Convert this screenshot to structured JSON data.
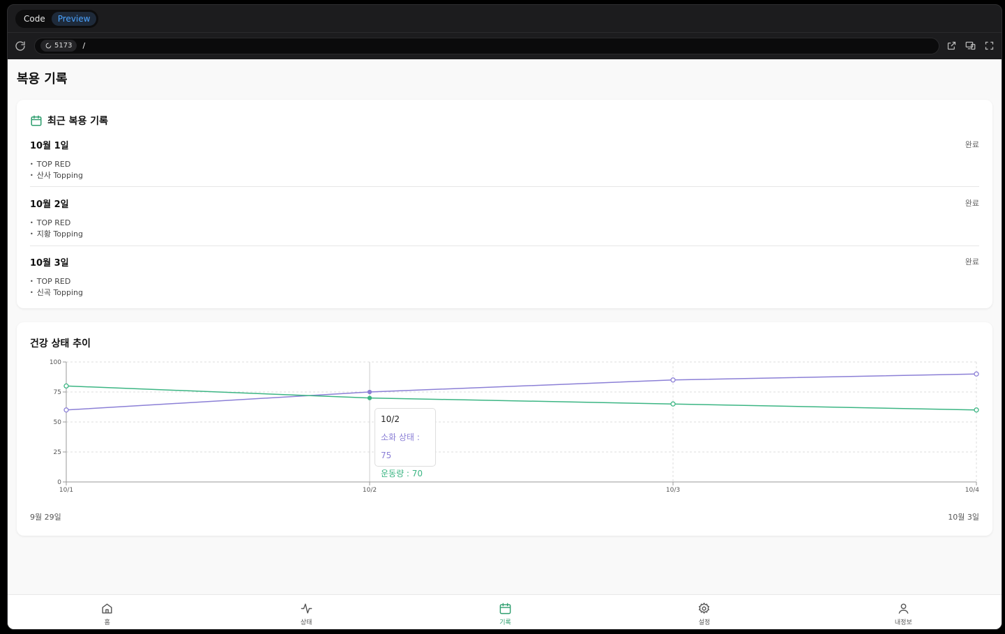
{
  "browser": {
    "tabs": [
      {
        "label": "Code"
      },
      {
        "label": "Preview"
      }
    ],
    "port": "5173",
    "path": "/"
  },
  "page": {
    "title": "복용 기록"
  },
  "recent": {
    "title": "최근 복용 기록",
    "entries": [
      {
        "date": "10월 1일",
        "status": "완료",
        "items": [
          "TOP RED",
          "산사 Topping"
        ]
      },
      {
        "date": "10월 2일",
        "status": "완료",
        "items": [
          "TOP RED",
          "지황 Topping"
        ]
      },
      {
        "date": "10월 3일",
        "status": "완료",
        "items": [
          "TOP RED",
          "신곡 Topping"
        ]
      }
    ]
  },
  "trend": {
    "title": "건강 상태 추이",
    "footer_left": "9월 29일",
    "footer_right": "10월 3일",
    "tooltip": {
      "label": "10/2",
      "rows": [
        {
          "text": "소화 상태 : 75",
          "color": "#8b7fd6"
        },
        {
          "text": "운동량 : 70",
          "color": "#3bb583"
        }
      ]
    }
  },
  "chart_data": {
    "type": "line",
    "categories": [
      "10/1",
      "10/2",
      "10/3",
      "10/4"
    ],
    "ylim": [
      0,
      100
    ],
    "yticks": [
      0,
      25,
      50,
      75,
      100
    ],
    "grid": true,
    "series": [
      {
        "name": "소화 상태",
        "color": "#8b7fd6",
        "values": [
          60,
          75,
          85,
          90
        ]
      },
      {
        "name": "운동량",
        "color": "#3bb583",
        "values": [
          80,
          70,
          65,
          60
        ]
      }
    ]
  },
  "nav": {
    "items": [
      {
        "label": "홈",
        "icon": "home-icon"
      },
      {
        "label": "상태",
        "icon": "activity-icon"
      },
      {
        "label": "기록",
        "icon": "calendar-icon"
      },
      {
        "label": "설정",
        "icon": "gear-icon"
      },
      {
        "label": "내정보",
        "icon": "user-icon"
      }
    ]
  },
  "colors": {
    "accent": "#2e9e6e",
    "purple": "#8b7fd6",
    "green": "#3bb583"
  }
}
